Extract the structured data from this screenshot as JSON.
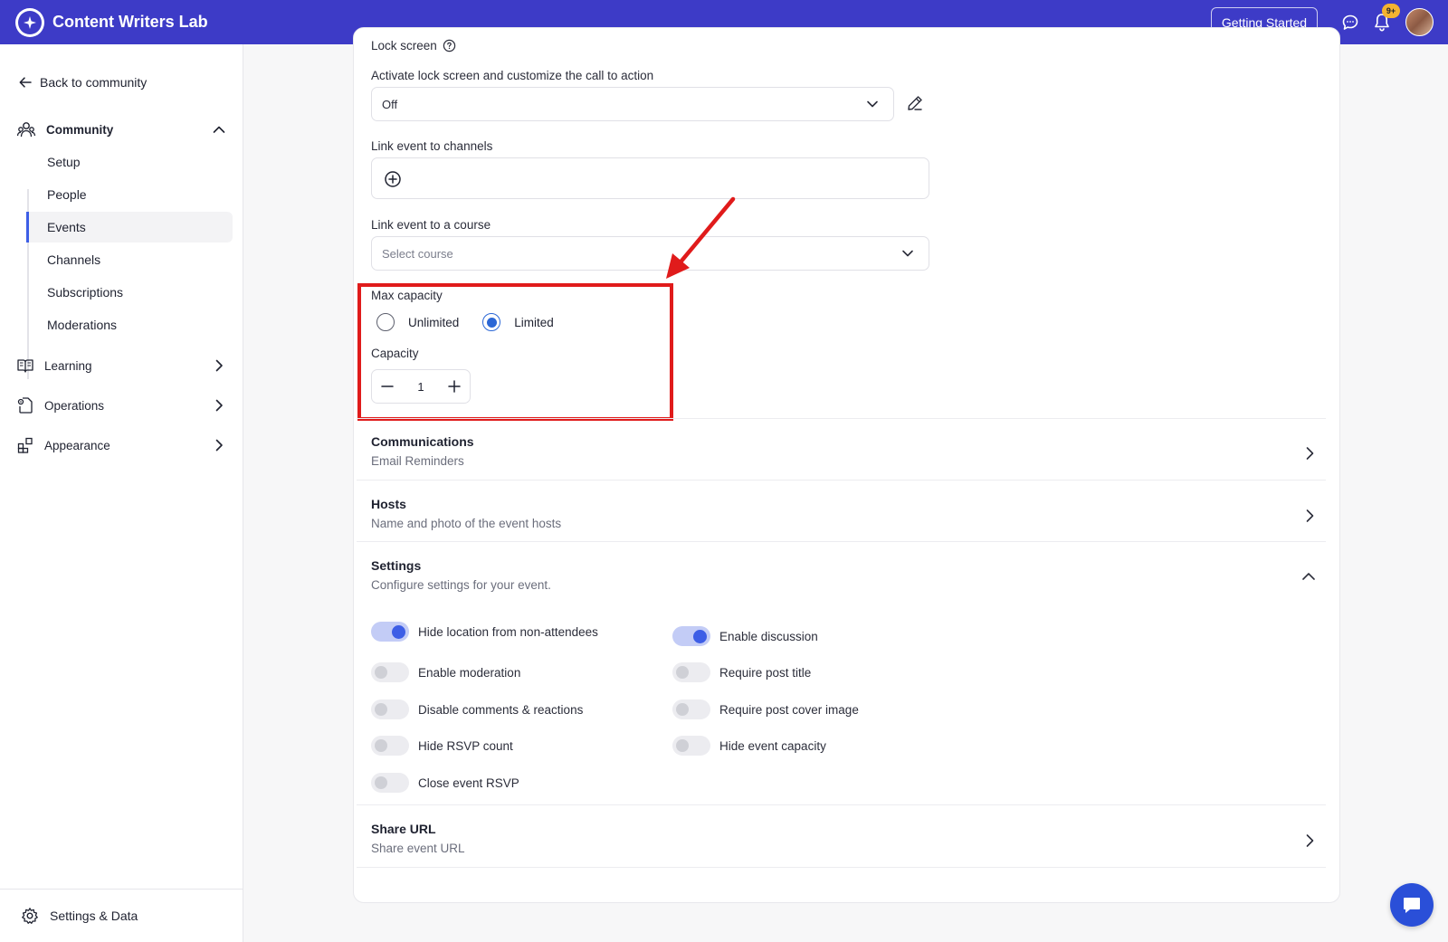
{
  "app": {
    "title": "Content Writers Lab"
  },
  "header": {
    "getting_started_label": "Getting Started",
    "notification_count": "9+"
  },
  "sidebar": {
    "back_label": "Back to community",
    "sections": [
      {
        "label": "Community",
        "icon": "community-icon",
        "expanded": true
      },
      {
        "label": "Learning",
        "icon": "book-icon",
        "expanded": false
      },
      {
        "label": "Operations",
        "icon": "operations-icon",
        "expanded": false
      },
      {
        "label": "Appearance",
        "icon": "appearance-icon",
        "expanded": false
      }
    ],
    "community_items": [
      {
        "label": "Setup"
      },
      {
        "label": "People"
      },
      {
        "label": "Events",
        "active": true
      },
      {
        "label": "Channels"
      },
      {
        "label": "Subscriptions"
      },
      {
        "label": "Moderations"
      }
    ],
    "footer_label": "Settings & Data"
  },
  "form": {
    "lock_screen_title": "Lock screen",
    "lock_screen_label": "Activate lock screen and customize the call to action",
    "lock_screen_value": "Off",
    "channels_label": "Link event to channels",
    "course_label": "Link event to a course",
    "course_placeholder": "Select course",
    "max_capacity_label": "Max capacity",
    "capacity_options": [
      {
        "label": "Unlimited",
        "checked": false
      },
      {
        "label": "Limited",
        "checked": true
      }
    ],
    "capacity_label": "Capacity",
    "capacity_value": "1"
  },
  "rows": [
    {
      "title": "Communications",
      "desc": "Email Reminders"
    },
    {
      "title": "Hosts",
      "desc": "Name and photo of the event hosts"
    },
    {
      "title": "Settings",
      "desc": "Configure settings for your event."
    },
    {
      "title": "Share URL",
      "desc": "Share event URL"
    }
  ],
  "settings_toggles": {
    "left": [
      {
        "label": "Hide location from non-attendees",
        "on": true
      },
      {
        "label": "Enable moderation",
        "on": false
      },
      {
        "label": "Disable comments & reactions",
        "on": false
      },
      {
        "label": "Hide RSVP count",
        "on": false
      },
      {
        "label": "Close event RSVP",
        "on": false
      }
    ],
    "right": [
      {
        "label": "Enable discussion",
        "on": true
      },
      {
        "label": "Require post title",
        "on": false
      },
      {
        "label": "Require post cover image",
        "on": false
      },
      {
        "label": "Hide event capacity",
        "on": false
      }
    ]
  },
  "colors": {
    "brand": "#3d3bc7",
    "accent": "#3d5ee6",
    "highlight": "#e01b1b"
  }
}
